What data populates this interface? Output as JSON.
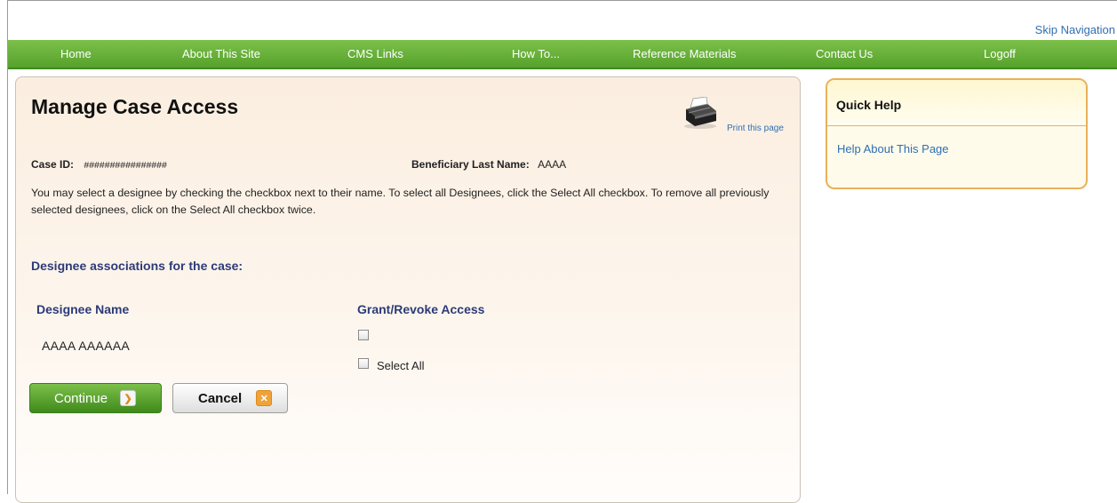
{
  "skip_nav": "Skip Navigation",
  "nav": {
    "items": [
      {
        "label": "Home"
      },
      {
        "label": "About This Site"
      },
      {
        "label": "CMS Links"
      },
      {
        "label": "How To..."
      },
      {
        "label": "Reference Materials"
      },
      {
        "label": "Contact Us"
      },
      {
        "label": "Logoff"
      }
    ]
  },
  "main": {
    "title": "Manage Case Access",
    "print_link": "Print this page",
    "case_id_label": "Case ID:",
    "case_id_value": "################",
    "beneficiary_label": "Beneficiary Last Name:",
    "beneficiary_value": "AAAA",
    "instructions": "You may select a designee by checking the checkbox next to their name. To select all Designees, click the Select All checkbox. To remove all previously selected designees, click on the Select All checkbox twice.",
    "section_heading": "Designee associations for the case:",
    "columns": {
      "name": "Designee Name",
      "access": "Grant/Revoke Access"
    },
    "designees": [
      {
        "name": "AAAA AAAAAA",
        "checked": false
      }
    ],
    "select_all": {
      "label": "Select All",
      "checked": false
    },
    "buttons": {
      "continue": "Continue",
      "cancel": "Cancel"
    }
  },
  "quick_help": {
    "title": "Quick Help",
    "link": "Help About This Page"
  },
  "colors": {
    "nav_green": "#56a22c",
    "link_blue": "#2f6fb3",
    "heading_navy": "#2d3a78",
    "help_border": "#e9b15a"
  },
  "icons": [
    "printer-icon",
    "arrow-right-icon",
    "close-icon",
    "checkbox-icon"
  ]
}
